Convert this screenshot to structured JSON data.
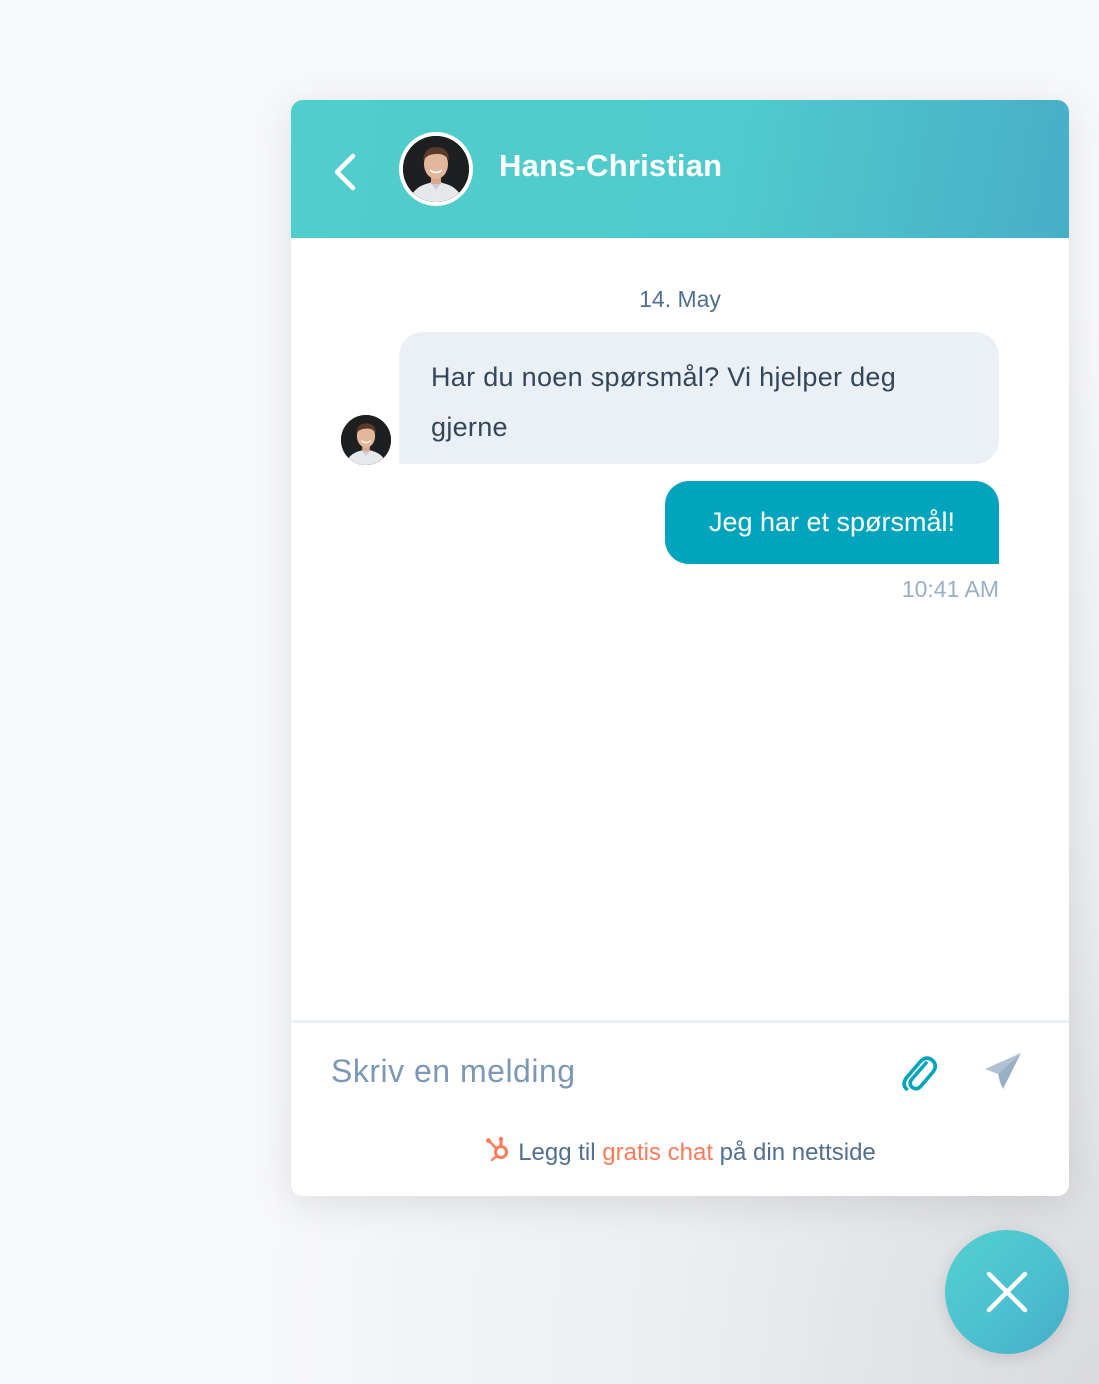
{
  "header": {
    "agent_name": "Hans-Christian",
    "back_icon": "chevron-left-icon",
    "gradient_start": "#51cdcd",
    "gradient_end": "#47aec8"
  },
  "conversation": {
    "date_label": "14. May",
    "messages": [
      {
        "sender": "agent",
        "text": "Har du noen spørsmål? Vi hjelper deg gjerne"
      },
      {
        "sender": "visitor",
        "text": "Jeg har et spørsmål!",
        "time": "10:41 AM"
      }
    ]
  },
  "composer": {
    "placeholder": "Skriv en melding",
    "value": "",
    "attach_icon": "paperclip-icon",
    "send_icon": "paper-plane-icon"
  },
  "branding": {
    "prefix": "Legg til",
    "link_text": "gratis chat",
    "suffix": "på din nettside",
    "logo_icon": "hubspot-sprocket-icon"
  },
  "launcher": {
    "icon": "close-icon"
  },
  "colors": {
    "accent": "#00a4bd",
    "agent_bubble": "#eaf0f6",
    "text_primary": "#33475b",
    "text_secondary": "#516f90",
    "muted": "#99afc4",
    "link": "#ff7a59"
  }
}
